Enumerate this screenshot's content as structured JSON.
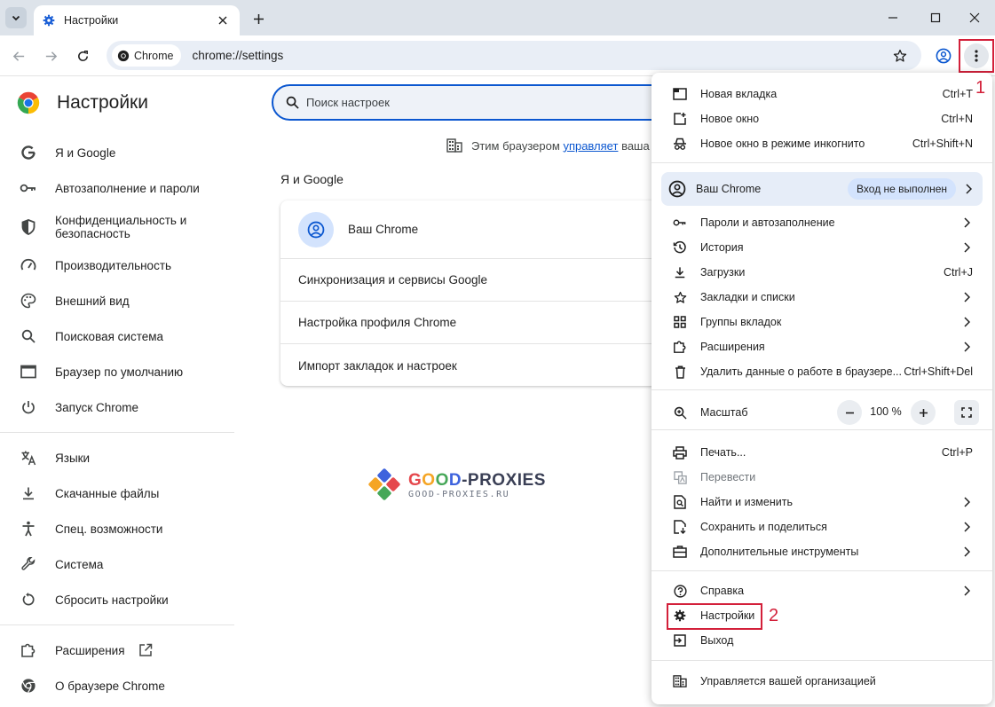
{
  "tab": {
    "title": "Настройки"
  },
  "toolbar": {
    "chip_label": "Chrome",
    "url": "chrome://settings"
  },
  "settings": {
    "title": "Настройки",
    "search_placeholder": "Поиск настроек",
    "managed": {
      "prefix": "Этим браузером",
      "link": "управляет",
      "suffix": "ваша организация"
    },
    "section_title": "Я и Google",
    "card": {
      "profile": "Ваш Chrome",
      "rows": [
        "Синхронизация и сервисы Google",
        "Настройка профиля Chrome",
        "Импорт закладок и настроек"
      ]
    }
  },
  "sidebar": {
    "items": [
      {
        "label": "Я и Google",
        "icon": "google-g-icon"
      },
      {
        "label": "Автозаполнение и пароли",
        "icon": "key-icon"
      },
      {
        "label": "Конфиденциальность и безопасность",
        "icon": "shield-icon"
      },
      {
        "label": "Производительность",
        "icon": "speedometer-icon"
      },
      {
        "label": "Внешний вид",
        "icon": "palette-icon"
      },
      {
        "label": "Поисковая система",
        "icon": "search-icon"
      },
      {
        "label": "Браузер по умолчанию",
        "icon": "browser-window-icon"
      },
      {
        "label": "Запуск Chrome",
        "icon": "power-icon"
      },
      {
        "label": "Языки",
        "icon": "translate-icon"
      },
      {
        "label": "Скачанные файлы",
        "icon": "download-icon"
      },
      {
        "label": "Спец. возможности",
        "icon": "accessibility-icon"
      },
      {
        "label": "Система",
        "icon": "wrench-icon"
      },
      {
        "label": "Сбросить настройки",
        "icon": "reset-icon"
      },
      {
        "label": "Расширения",
        "icon": "puzzle-icon"
      },
      {
        "label": "О браузере Chrome",
        "icon": "chrome-logo-icon"
      }
    ]
  },
  "menu": {
    "new_tab": {
      "label": "Новая вкладка",
      "shortcut": "Ctrl+T"
    },
    "new_window": {
      "label": "Новое окно",
      "shortcut": "Ctrl+N"
    },
    "incognito": {
      "label": "Новое окно в режиме инкогнито",
      "shortcut": "Ctrl+Shift+N"
    },
    "profile": {
      "label": "Ваш Chrome",
      "badge": "Вход не выполнен"
    },
    "passwords": {
      "label": "Пароли и автозаполнение"
    },
    "history": {
      "label": "История"
    },
    "downloads": {
      "label": "Загрузки",
      "shortcut": "Ctrl+J"
    },
    "bookmarks": {
      "label": "Закладки и списки"
    },
    "tab_groups": {
      "label": "Группы вкладок"
    },
    "extensions": {
      "label": "Расширения"
    },
    "clear_data": {
      "label": "Удалить данные о работе в браузере...",
      "shortcut": "Ctrl+Shift+Del"
    },
    "zoom": {
      "label": "Масштаб",
      "value": "100 %"
    },
    "print": {
      "label": "Печать...",
      "shortcut": "Ctrl+P"
    },
    "translate": {
      "label": "Перевести"
    },
    "find": {
      "label": "Найти и изменить"
    },
    "save_share": {
      "label": "Сохранить и поделиться"
    },
    "more_tools": {
      "label": "Дополнительные инструменты"
    },
    "help": {
      "label": "Справка"
    },
    "settings": {
      "label": "Настройки"
    },
    "exit": {
      "label": "Выход"
    },
    "managed": {
      "label": "Управляется вашей организацией"
    }
  },
  "annotations": {
    "step1": "1",
    "step2": "2"
  },
  "watermark": {
    "brand_a": "G",
    "brand_b": "O",
    "brand_c": "O",
    "brand_d": "D",
    "brand_rest": "-PROXIES",
    "site": "GOOD-PROXIES.RU"
  },
  "colors": {
    "accent": "#0b57d0",
    "highlight": "#d3203a",
    "tabstrip": "#dde3ea",
    "omnibox": "#e9eef6"
  }
}
